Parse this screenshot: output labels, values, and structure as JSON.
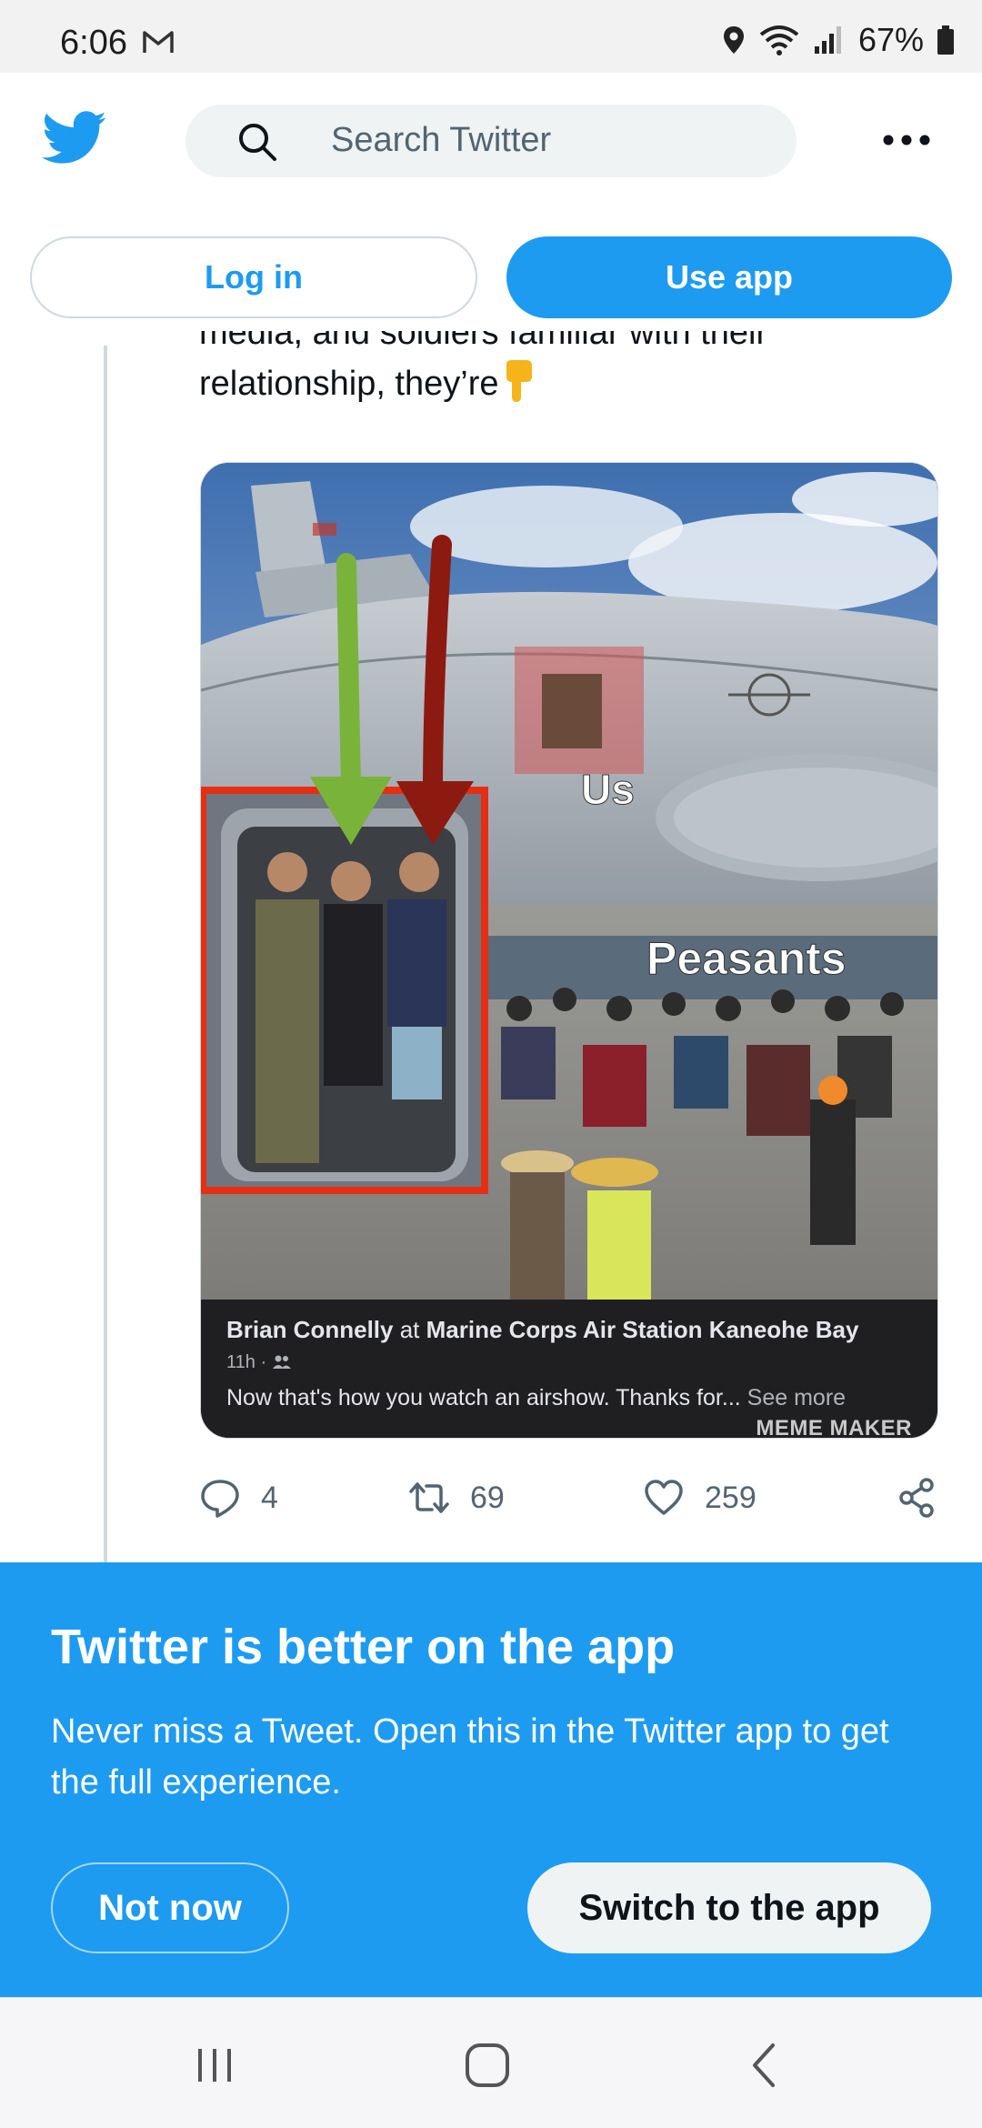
{
  "status_bar": {
    "time": "6:06",
    "battery": "67%",
    "icons": [
      "gmail-icon",
      "location-icon",
      "wifi-icon",
      "signal-icon",
      "battery-icon"
    ]
  },
  "header": {
    "logo": "twitter-bird-icon",
    "search_placeholder": "Search Twitter",
    "more": "more-icon"
  },
  "auth": {
    "login_label": "Log in",
    "use_app_label": "Use app"
  },
  "tweet": {
    "text_line1": "media, and soldiers familiar with their",
    "text_line2": "relationship, they’re",
    "emoji": "pointing-down-emoji",
    "image": {
      "label_us": "Us",
      "label_peasants": "Peasants",
      "fb_author": "Brian Connelly",
      "fb_at": " at ",
      "fb_place": "Marine Corps Air Station Kaneohe Bay",
      "fb_meta": "11h · ",
      "fb_text": "Now that's how you watch an airshow. Thanks for... ",
      "fb_see_more": "See more",
      "watermark": "MEME MAKER"
    },
    "actions": {
      "replies": "4",
      "retweets": "69",
      "likes": "259"
    }
  },
  "promo": {
    "title": "Twitter is better on the app",
    "body": "Never miss a Tweet. Open this in the Twitter app to get the full experience.",
    "not_now_label": "Not now",
    "switch_label": "Switch to the app"
  },
  "colors": {
    "brand": "#1d9bf0",
    "text": "#0f1419",
    "secondary": "#536471"
  }
}
